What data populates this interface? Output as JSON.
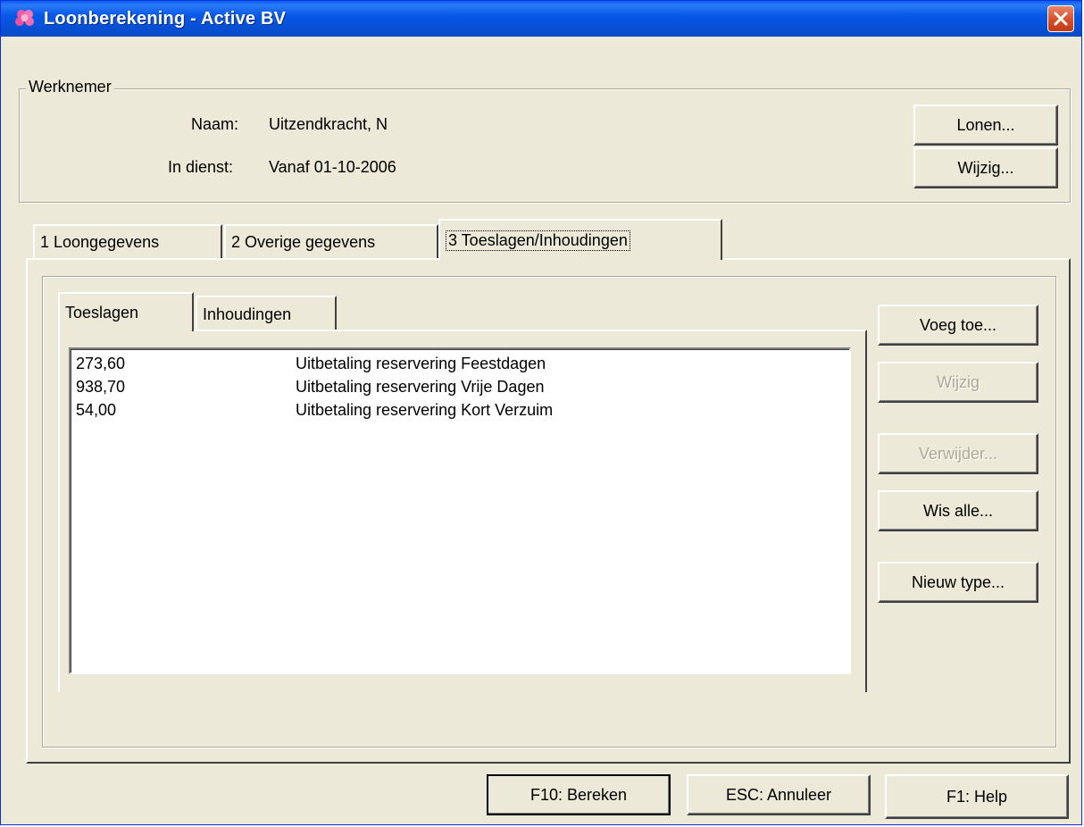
{
  "window": {
    "title": "Loonberekening - Active BV"
  },
  "employee": {
    "group_label": "Werknemer",
    "name_label": "Naam:",
    "name_value": "Uitzendkracht, N",
    "service_label": "In dienst:",
    "service_value": "Vanaf 01-10-2006",
    "buttons": {
      "lonen": "Lonen...",
      "wijzig": "Wijzig..."
    }
  },
  "main_tabs": [
    {
      "label": "1 Loongegevens"
    },
    {
      "label": "2 Overige gegevens"
    },
    {
      "label": "3 Toeslagen/Inhoudingen"
    }
  ],
  "sub_tabs": [
    {
      "label": "Toeslagen"
    },
    {
      "label": "Inhoudingen"
    }
  ],
  "items": [
    {
      "amount": "273,60",
      "description": "Uitbetaling reservering Feestdagen"
    },
    {
      "amount": "938,70",
      "description": "Uitbetaling reservering Vrije Dagen"
    },
    {
      "amount": "54,00",
      "description": "Uitbetaling reservering Kort Verzuim"
    }
  ],
  "side_buttons": {
    "add": "Voeg toe...",
    "edit": "Wijzig",
    "delete": "Verwijder...",
    "clear_all": "Wis alle...",
    "new_type": "Nieuw type..."
  },
  "footer_buttons": {
    "calculate": "F10: Bereken",
    "cancel": "ESC: Annuleer",
    "help": "F1: Help"
  }
}
